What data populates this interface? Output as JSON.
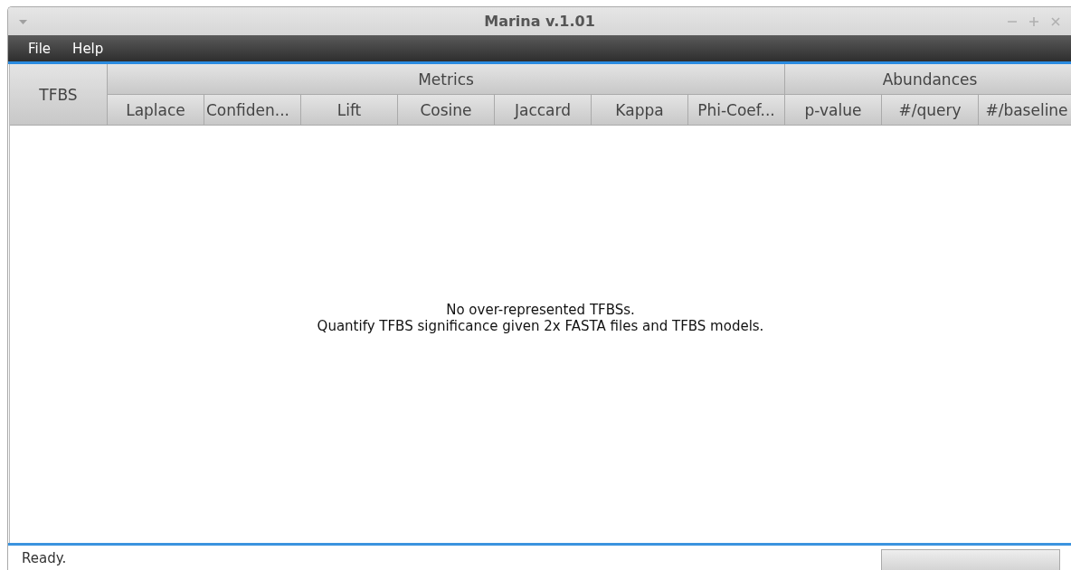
{
  "window": {
    "title": "Marina v.1.01"
  },
  "menu": [
    "File",
    "Help"
  ],
  "table": {
    "row_header": "TFBS",
    "groups": [
      {
        "label": "Metrics",
        "columns": [
          "Laplace",
          "Confiden...",
          "Lift",
          "Cosine",
          "Jaccard",
          "Kappa",
          "Phi-Coef..."
        ]
      },
      {
        "label": "Abundances",
        "columns": [
          "p-value",
          "#/query",
          "#/baseline"
        ]
      }
    ],
    "empty_message": [
      "No over-represented TFBSs.",
      "Quantify TFBS significance given 2x FASTA files and TFBS models."
    ]
  },
  "status_bar": {
    "text": "Ready.",
    "progress": {
      "level": 0
    }
  }
}
